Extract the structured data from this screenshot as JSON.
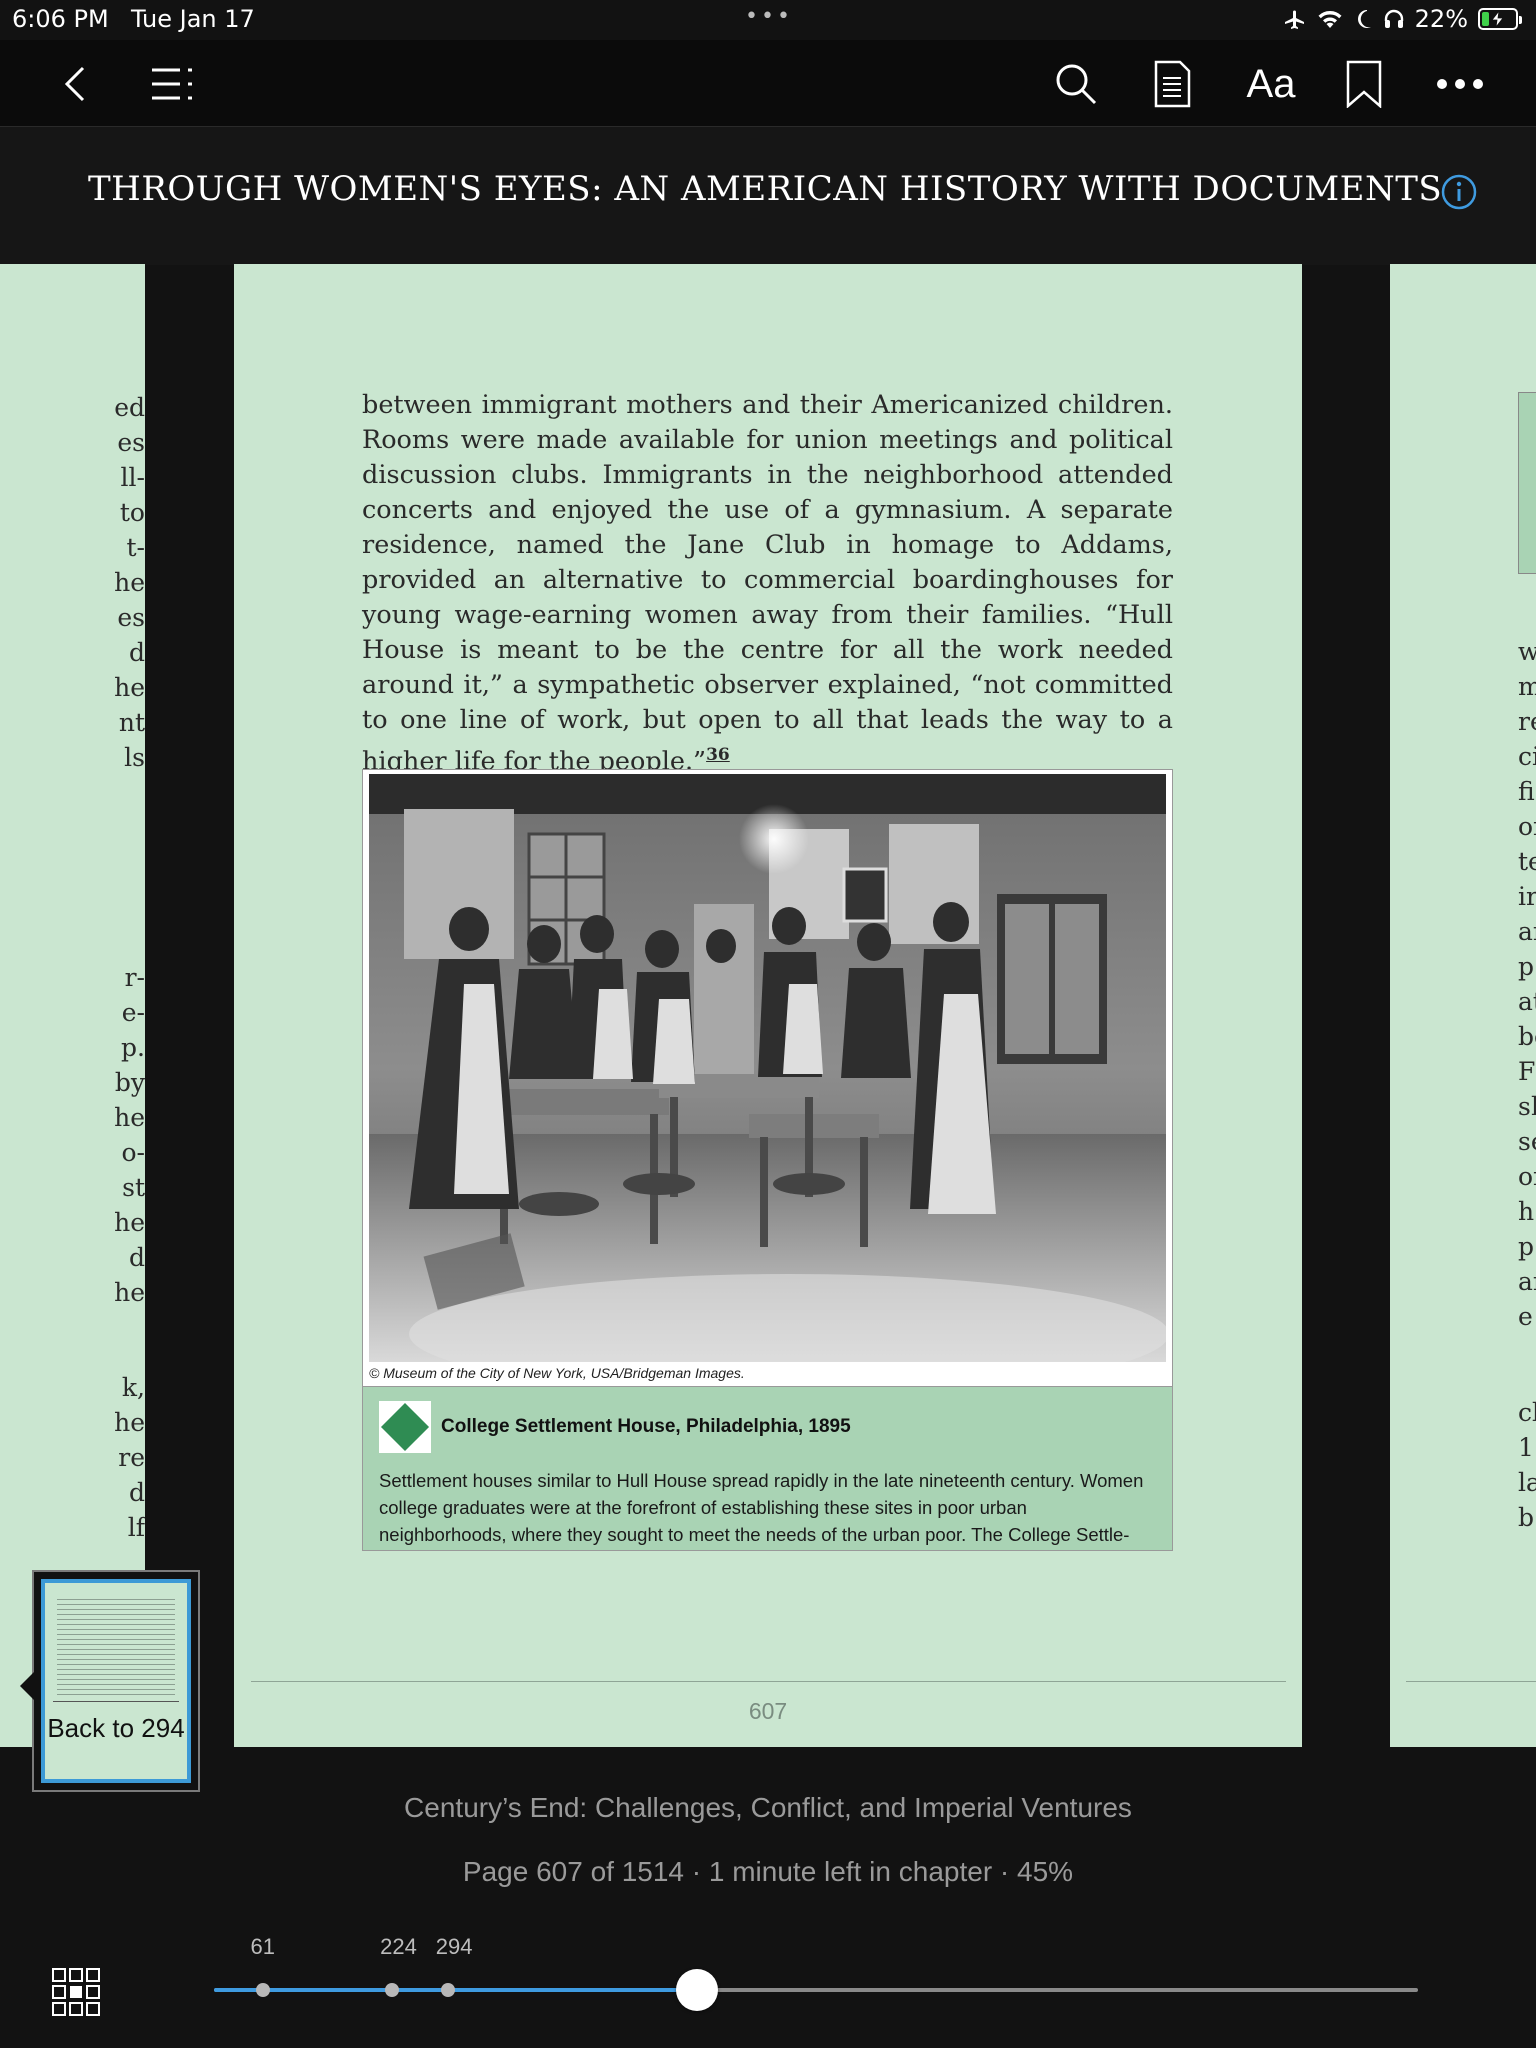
{
  "status_bar": {
    "time": "6:06 PM",
    "date": "Tue Jan 17",
    "battery_percent": "22%",
    "battery_level": 0.22,
    "icons": [
      "airplane-icon",
      "wifi-icon",
      "moon-icon",
      "headphones-icon",
      "battery-charging-icon"
    ]
  },
  "toolbar": {
    "icons": [
      "back-chevron-icon",
      "table-of-contents-icon",
      "search-icon",
      "notebook-icon",
      "font-settings-icon",
      "bookmark-icon",
      "more-icon"
    ],
    "font_label": "Aa"
  },
  "book": {
    "title": "THROUGH WOMEN'S EYES: AN AMERICAN HISTORY WITH DOCUMENTS",
    "info_icon": "info-icon"
  },
  "page": {
    "body_text": "between immigrant mothers and their Americanized children. Rooms were made available for union meetings and political discussion clubs. Immigrants in the neighborhood attended concerts and enjoyed the use of a gymnasium. A separate residence, named the Jane Club in homage to Addams, provided an alternative to commercial boardinghouses for young wage-earning women away from their families. “Hull House is meant to be the centre for all the work needed around it,” a sympathetic observer explained, “not committed to one line of work, but open to all that leads the way to a higher life for the people.”",
    "footnote": "36",
    "figure_credit": "© Museum of the City of New York, USA/Bridgeman Images.",
    "figure_title": "College Settlement House, Philadelphia, 1895",
    "figure_caption": "Settlement houses similar to Hull House spread rapidly in the late nineteenth century. Women college graduates were at the forefront of establishing these sites in poor urban neighborhoods, where they sought to meet the needs of the urban poor. The College Settle-",
    "page_number": "607"
  },
  "left_page_fragments": [
    "ed",
    "es",
    "ll-",
    "to",
    "t-",
    "he",
    "es",
    "d",
    "he",
    "nt",
    "ls",
    "r-",
    "e-",
    "p.",
    "by",
    "he",
    "o-",
    "st",
    "he",
    "d",
    "he",
    "k,",
    "he",
    "re",
    "d",
    "lf"
  ],
  "right_page_fragments": [
    "w",
    "m",
    "re",
    "ci",
    "fi",
    "of",
    "te",
    "ir",
    "ar",
    "p",
    "at",
    "be",
    "Fi",
    "sh",
    "se",
    "of",
    "h",
    "p",
    "ar",
    "e",
    "cl",
    "1",
    "la",
    "b"
  ],
  "back_popup": {
    "label": "Back to 294"
  },
  "footer": {
    "chapter_title": "Century’s End: Challenges, Conflict, and Imperial Ventures",
    "progress_text": "Page 607 of 1514 · 1 minute left in chapter · 45%"
  },
  "slider": {
    "current_page": 607,
    "total_pages": 1514,
    "marks": [
      {
        "label": "61"
      },
      {
        "label": "224"
      },
      {
        "label": "294"
      }
    ]
  },
  "colors": {
    "page_bg": "#cae6d0",
    "accent_blue": "#3f9be0",
    "caption_bg": "#a9d3b4",
    "diamond_green": "#2f8c53"
  }
}
